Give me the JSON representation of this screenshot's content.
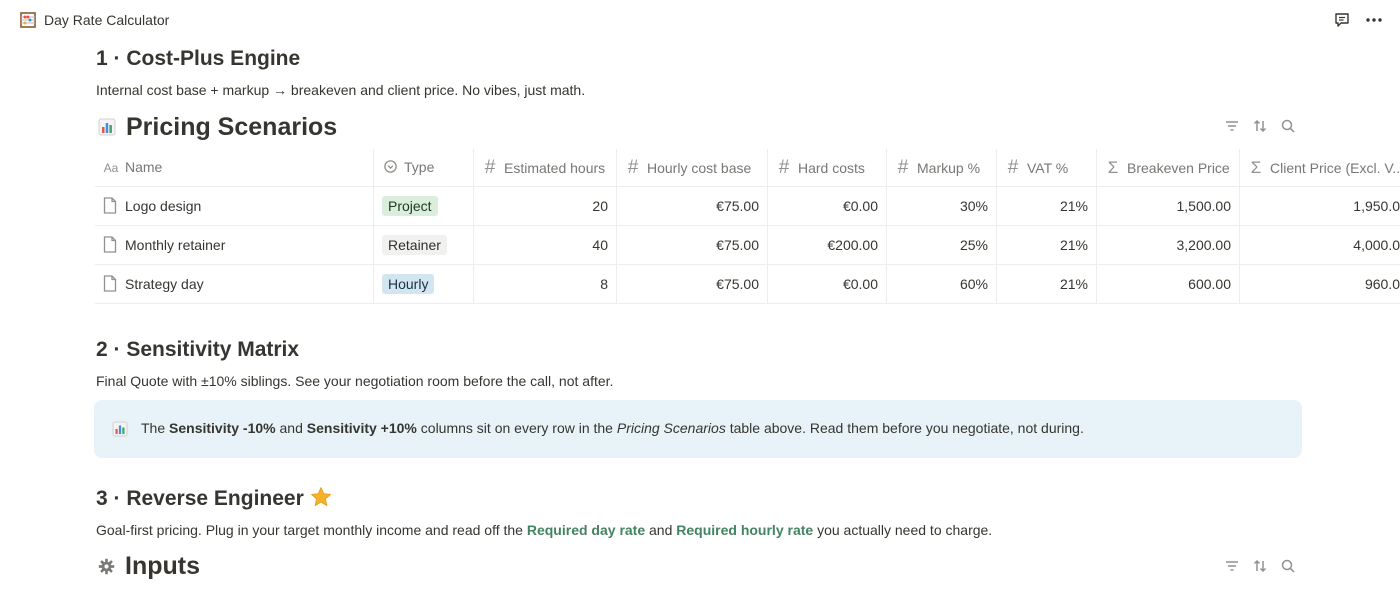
{
  "app": {
    "page_title": "Day Rate Calculator",
    "page_icon": "abacus-icon"
  },
  "sections": {
    "s1": {
      "heading": "1 · Cost-Plus Engine",
      "description": "Internal cost base + markup → breakeven and client price. No vibes, just math."
    },
    "s2": {
      "heading": "2 · Sensitivity Matrix",
      "description": "Final Quote with ±10% siblings. See your negotiation room before the call, not after."
    },
    "s3": {
      "heading": "3 · Reverse Engineer",
      "desc_pre": "Goal-first pricing. Plug in your target monthly income and read off the ",
      "desc_link1": "Required day rate",
      "desc_mid": " and ",
      "desc_link2": "Required hourly rate",
      "desc_post": " you actually need to charge."
    }
  },
  "pricing_db": {
    "title": "Pricing Scenarios",
    "icon": "bar-chart-icon",
    "columns": [
      {
        "label": "Name",
        "icon": "Aa"
      },
      {
        "label": "Type",
        "icon": "select-icon"
      },
      {
        "label": "Estimated hours",
        "icon": "#"
      },
      {
        "label": "Hourly cost base",
        "icon": "#"
      },
      {
        "label": "Hard costs",
        "icon": "#"
      },
      {
        "label": "Markup %",
        "icon": "#"
      },
      {
        "label": "VAT %",
        "icon": "#"
      },
      {
        "label": "Breakeven Price",
        "icon": "Σ"
      },
      {
        "label": "Client Price (Excl. V...",
        "icon": "Σ"
      }
    ],
    "rows": [
      {
        "name": "Logo design",
        "type": "Project",
        "hours": "20",
        "hourly": "€75.00",
        "hard": "€0.00",
        "markup": "30%",
        "vat": "21%",
        "breakeven": "1,500.00",
        "client": "1,950.0"
      },
      {
        "name": "Monthly retainer",
        "type": "Retainer",
        "hours": "40",
        "hourly": "€75.00",
        "hard": "€200.00",
        "markup": "25%",
        "vat": "21%",
        "breakeven": "3,200.00",
        "client": "4,000.0"
      },
      {
        "name": "Strategy day",
        "type": "Hourly",
        "hours": "8",
        "hourly": "€75.00",
        "hard": "€0.00",
        "markup": "60%",
        "vat": "21%",
        "breakeven": "600.00",
        "client": "960.0"
      }
    ],
    "tag_colors": {
      "Project": "#dbeddb",
      "Retainer": "#f1f1ef",
      "Hourly": "#d3e5ef"
    }
  },
  "callout": {
    "icon": "bar-chart-icon",
    "t1": "The ",
    "b1": "Sensitivity -10%",
    "t2": " and ",
    "b2": "Sensitivity +10%",
    "t3": " columns sit on every row in the ",
    "i1": "Pricing Scenarios",
    "t4": " table above. Read them before you negotiate, not during."
  },
  "inputs_db": {
    "title": "Inputs",
    "icon": "gear-icon"
  },
  "colors": {
    "accent_green": "#448361",
    "callout_bg": "#e7f3f8"
  }
}
